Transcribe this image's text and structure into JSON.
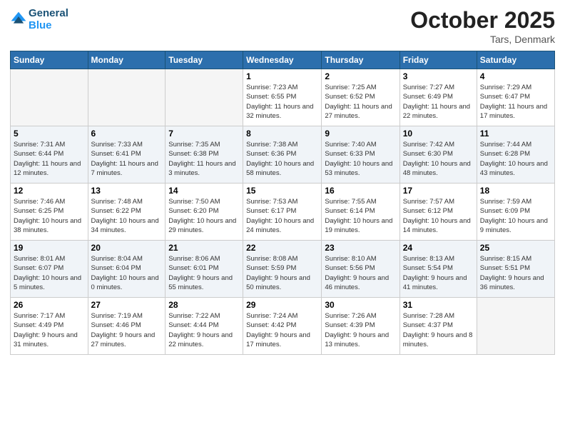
{
  "logo": {
    "line1": "General",
    "line2": "Blue"
  },
  "header": {
    "month": "October 2025",
    "location": "Tars, Denmark"
  },
  "weekdays": [
    "Sunday",
    "Monday",
    "Tuesday",
    "Wednesday",
    "Thursday",
    "Friday",
    "Saturday"
  ],
  "weeks": [
    [
      {
        "day": "",
        "empty": true
      },
      {
        "day": "",
        "empty": true
      },
      {
        "day": "",
        "empty": true
      },
      {
        "day": "1",
        "sunrise": "7:23 AM",
        "sunset": "6:55 PM",
        "daylight": "11 hours and 32 minutes."
      },
      {
        "day": "2",
        "sunrise": "7:25 AM",
        "sunset": "6:52 PM",
        "daylight": "11 hours and 27 minutes."
      },
      {
        "day": "3",
        "sunrise": "7:27 AM",
        "sunset": "6:49 PM",
        "daylight": "11 hours and 22 minutes."
      },
      {
        "day": "4",
        "sunrise": "7:29 AM",
        "sunset": "6:47 PM",
        "daylight": "11 hours and 17 minutes."
      }
    ],
    [
      {
        "day": "5",
        "sunrise": "7:31 AM",
        "sunset": "6:44 PM",
        "daylight": "11 hours and 12 minutes."
      },
      {
        "day": "6",
        "sunrise": "7:33 AM",
        "sunset": "6:41 PM",
        "daylight": "11 hours and 7 minutes."
      },
      {
        "day": "7",
        "sunrise": "7:35 AM",
        "sunset": "6:38 PM",
        "daylight": "11 hours and 3 minutes."
      },
      {
        "day": "8",
        "sunrise": "7:38 AM",
        "sunset": "6:36 PM",
        "daylight": "10 hours and 58 minutes."
      },
      {
        "day": "9",
        "sunrise": "7:40 AM",
        "sunset": "6:33 PM",
        "daylight": "10 hours and 53 minutes."
      },
      {
        "day": "10",
        "sunrise": "7:42 AM",
        "sunset": "6:30 PM",
        "daylight": "10 hours and 48 minutes."
      },
      {
        "day": "11",
        "sunrise": "7:44 AM",
        "sunset": "6:28 PM",
        "daylight": "10 hours and 43 minutes."
      }
    ],
    [
      {
        "day": "12",
        "sunrise": "7:46 AM",
        "sunset": "6:25 PM",
        "daylight": "10 hours and 38 minutes."
      },
      {
        "day": "13",
        "sunrise": "7:48 AM",
        "sunset": "6:22 PM",
        "daylight": "10 hours and 34 minutes."
      },
      {
        "day": "14",
        "sunrise": "7:50 AM",
        "sunset": "6:20 PM",
        "daylight": "10 hours and 29 minutes."
      },
      {
        "day": "15",
        "sunrise": "7:53 AM",
        "sunset": "6:17 PM",
        "daylight": "10 hours and 24 minutes."
      },
      {
        "day": "16",
        "sunrise": "7:55 AM",
        "sunset": "6:14 PM",
        "daylight": "10 hours and 19 minutes."
      },
      {
        "day": "17",
        "sunrise": "7:57 AM",
        "sunset": "6:12 PM",
        "daylight": "10 hours and 14 minutes."
      },
      {
        "day": "18",
        "sunrise": "7:59 AM",
        "sunset": "6:09 PM",
        "daylight": "10 hours and 9 minutes."
      }
    ],
    [
      {
        "day": "19",
        "sunrise": "8:01 AM",
        "sunset": "6:07 PM",
        "daylight": "10 hours and 5 minutes."
      },
      {
        "day": "20",
        "sunrise": "8:04 AM",
        "sunset": "6:04 PM",
        "daylight": "10 hours and 0 minutes."
      },
      {
        "day": "21",
        "sunrise": "8:06 AM",
        "sunset": "6:01 PM",
        "daylight": "9 hours and 55 minutes."
      },
      {
        "day": "22",
        "sunrise": "8:08 AM",
        "sunset": "5:59 PM",
        "daylight": "9 hours and 50 minutes."
      },
      {
        "day": "23",
        "sunrise": "8:10 AM",
        "sunset": "5:56 PM",
        "daylight": "9 hours and 46 minutes."
      },
      {
        "day": "24",
        "sunrise": "8:13 AM",
        "sunset": "5:54 PM",
        "daylight": "9 hours and 41 minutes."
      },
      {
        "day": "25",
        "sunrise": "8:15 AM",
        "sunset": "5:51 PM",
        "daylight": "9 hours and 36 minutes."
      }
    ],
    [
      {
        "day": "26",
        "sunrise": "7:17 AM",
        "sunset": "4:49 PM",
        "daylight": "9 hours and 31 minutes."
      },
      {
        "day": "27",
        "sunrise": "7:19 AM",
        "sunset": "4:46 PM",
        "daylight": "9 hours and 27 minutes."
      },
      {
        "day": "28",
        "sunrise": "7:22 AM",
        "sunset": "4:44 PM",
        "daylight": "9 hours and 22 minutes."
      },
      {
        "day": "29",
        "sunrise": "7:24 AM",
        "sunset": "4:42 PM",
        "daylight": "9 hours and 17 minutes."
      },
      {
        "day": "30",
        "sunrise": "7:26 AM",
        "sunset": "4:39 PM",
        "daylight": "9 hours and 13 minutes."
      },
      {
        "day": "31",
        "sunrise": "7:28 AM",
        "sunset": "4:37 PM",
        "daylight": "9 hours and 8 minutes."
      },
      {
        "day": "",
        "empty": true
      }
    ]
  ]
}
